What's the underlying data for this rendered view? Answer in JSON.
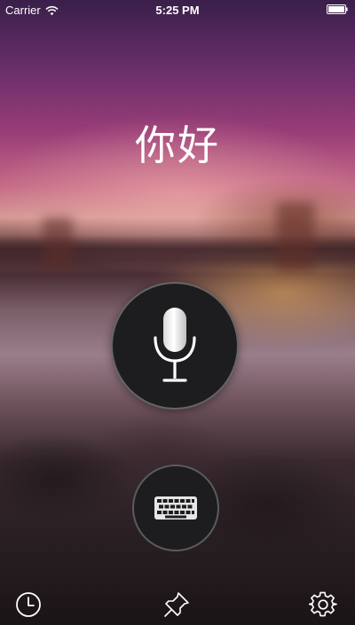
{
  "status_bar": {
    "carrier": "Carrier",
    "time": "5:25 PM",
    "wifi_icon": "wifi-icon",
    "battery_icon": "battery-icon"
  },
  "main": {
    "greeting": "你好",
    "mic_button_icon": "microphone-icon",
    "keyboard_button_icon": "keyboard-icon"
  },
  "toolbar": {
    "history_icon": "clock-icon",
    "pin_icon": "pin-icon",
    "settings_icon": "gear-icon"
  },
  "colors": {
    "button_fill": "#1d1c1f",
    "text": "#ffffff"
  }
}
